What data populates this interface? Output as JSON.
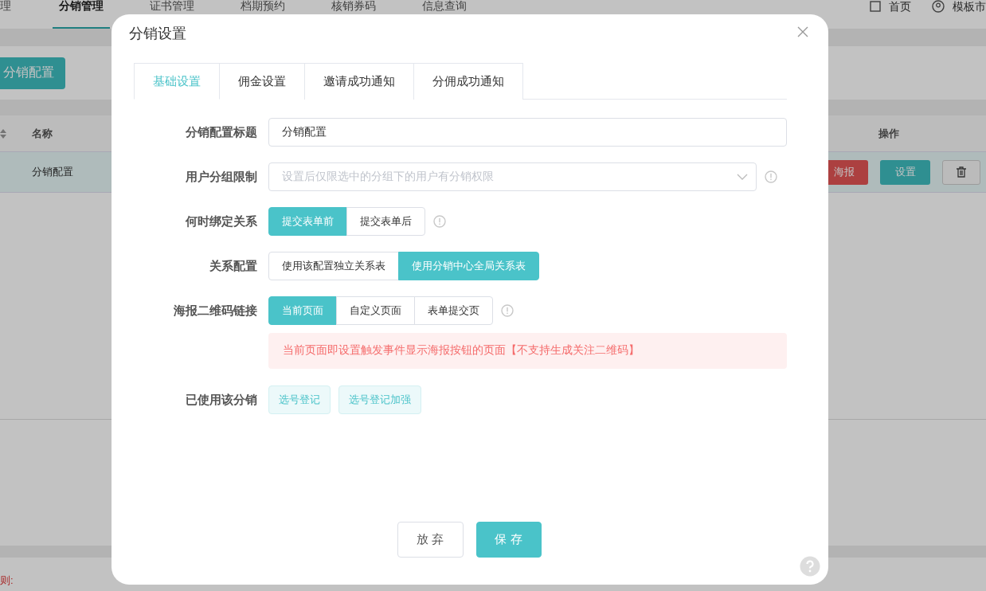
{
  "background": {
    "nav": {
      "items": [
        {
          "label": "理",
          "selected": false
        },
        {
          "label": "分销管理",
          "selected": true
        },
        {
          "label": "证书管理",
          "selected": false
        },
        {
          "label": "档期预约",
          "selected": false
        },
        {
          "label": "核销券码",
          "selected": false
        },
        {
          "label": "信息查询",
          "selected": false
        }
      ],
      "links": [
        {
          "label": "首页",
          "kind": "home"
        },
        {
          "label": "模板市",
          "kind": "market"
        }
      ]
    },
    "add_button": "分销配置",
    "table": {
      "columns": [
        "名称",
        "操作"
      ],
      "rows": [
        {
          "name": "分销配置",
          "actions": [
            {
              "kind": "danger",
              "label": "海报"
            },
            {
              "kind": "primary",
              "label": "设置"
            },
            {
              "kind": "delete"
            }
          ]
        }
      ]
    },
    "footer_note": "则:"
  },
  "dialog": {
    "title": "分销设置",
    "tabs": [
      {
        "label": "基础设置",
        "selected": true
      },
      {
        "label": "佣金设置",
        "selected": false
      },
      {
        "label": "邀请成功通知",
        "selected": false
      },
      {
        "label": "分佣成功通知",
        "selected": false
      }
    ],
    "fields": [
      {
        "kind": "input",
        "label": "分销配置标题",
        "value": "分销配置",
        "info": false
      },
      {
        "kind": "select",
        "label": "用户分组限制",
        "placeholder": "设置后仅限选中的分组下的用户有分销权限",
        "info": true
      },
      {
        "kind": "segmented",
        "label": "何时绑定关系",
        "info": true,
        "options": [
          {
            "label": "提交表单前",
            "selected": true
          },
          {
            "label": "提交表单后",
            "selected": false
          }
        ]
      },
      {
        "kind": "segmented",
        "label": "关系配置",
        "info": false,
        "options": [
          {
            "label": "使用该配置独立关系表",
            "selected": false
          },
          {
            "label": "使用分销中心全局关系表",
            "selected": true
          }
        ]
      },
      {
        "kind": "segmented",
        "label": "海报二维码链接",
        "info": true,
        "options": [
          {
            "label": "当前页面",
            "selected": true
          },
          {
            "label": "自定义页面",
            "selected": false
          },
          {
            "label": "表单提交页",
            "selected": false
          }
        ]
      },
      {
        "kind": "notice",
        "text": "当前页面即设置触发事件显示海报按钮的页面【不支持生成关注二维码】"
      },
      {
        "kind": "tags",
        "label": "已使用该分销",
        "tags": [
          "选号登记",
          "选号登记加强"
        ]
      }
    ],
    "buttons": [
      {
        "label": "放 弃",
        "kind": "secondary"
      },
      {
        "label": "保 存",
        "kind": "primary"
      }
    ]
  }
}
